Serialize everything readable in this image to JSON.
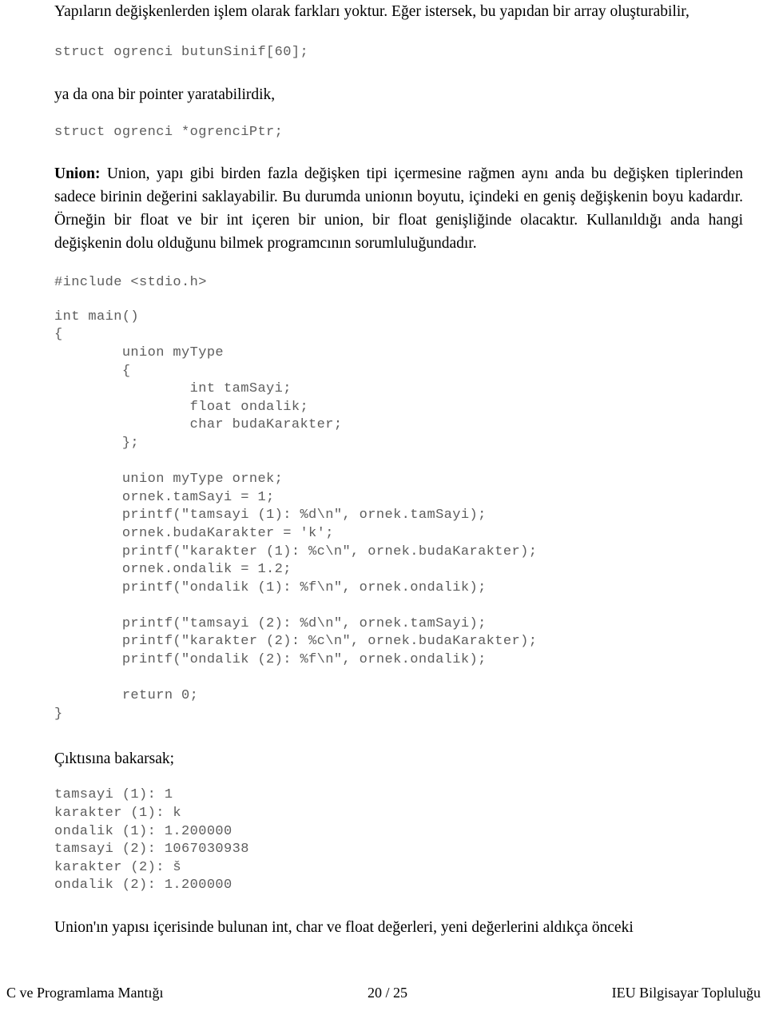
{
  "document": {
    "language": "tr",
    "body": {
      "intro_paragraph": "Yapıların değişkenlerden işlem olarak farkları yoktur. Eğer istersek, bu yapıdan bir array oluşturabilir,",
      "code_array_decl": "struct ogrenci butunSinif[60];",
      "pointer_paragraph": "ya da ona bir pointer yaratabilirdik,",
      "code_pointer_decl": "struct ogrenci *ogrenciPtr;",
      "union_lead": "Union:",
      "union_paragraph": " Union, yapı gibi birden fazla değişken tipi içermesine rağmen aynı anda bu değişken tiplerinden sadece birinin değerini saklayabilir. Bu durumda unionın boyutu, içindeki en geniş değişkenin boyu kadardır. Örneğin bir float ve bir int içeren bir union, bir float genişliğinde olacaktır. Kullanıldığı anda hangi değişkenin dolu olduğunu bilmek programcının sorumluluğundadır.",
      "code_include": "#include <stdio.h>",
      "code_main_block": "int main()\n{\n        union myType\n        {\n                int tamSayi;\n                float ondalik;\n                char budaKarakter;\n        };\n\n        union myType ornek;\n        ornek.tamSayi = 1;\n        printf(\"tamsayi (1): %d\\n\", ornek.tamSayi);\n        ornek.budaKarakter = 'k';\n        printf(\"karakter (1): %c\\n\", ornek.budaKarakter);\n        ornek.ondalik = 1.2;\n        printf(\"ondalik (1): %f\\n\", ornek.ondalik);\n\n        printf(\"tamsayi (2): %d\\n\", ornek.tamSayi);\n        printf(\"karakter (2): %c\\n\", ornek.budaKarakter);\n        printf(\"ondalik (2): %f\\n\", ornek.ondalik);\n\n        return 0;\n}",
      "output_heading": "Çıktısına bakarsak;",
      "program_output": "tamsayi (1): 1\nkarakter (1): k\nondalik (1): 1.200000\ntamsayi (2): 1067030938\nkarakter (2): š\nondalik (2): 1.200000",
      "closing_paragraph": "Union'ın yapısı içerisinde bulunan int, char ve float değerleri, yeni değerlerini aldıkça önceki"
    },
    "footer": {
      "left": "C ve Programlama Mantığı",
      "page_number": "20 / 25",
      "right": "IEU Bilgisayar Topluluğu"
    },
    "colors": {
      "body_text": "#000000",
      "code_text": "#5d5d5d",
      "page_background": "#ffffff"
    }
  }
}
